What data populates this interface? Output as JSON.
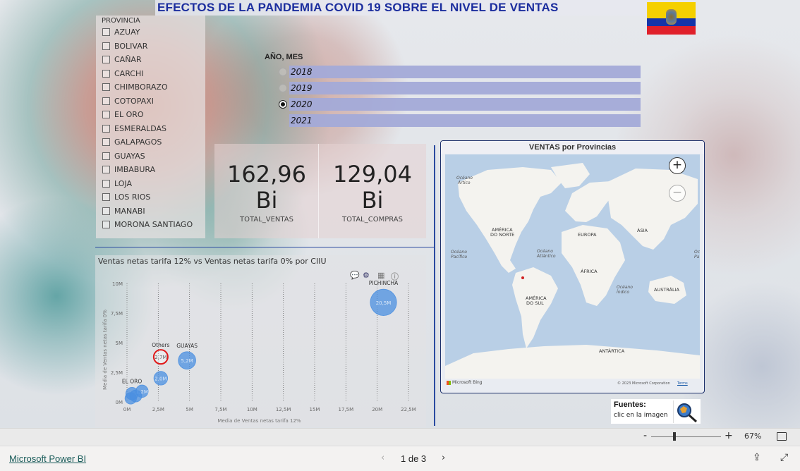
{
  "title": "EFECTOS DE LA PANDEMIA COVID 19 SOBRE EL NIVEL DE VENTAS",
  "flag_colors": {
    "yellow": "#f5d000",
    "blue": "#1534a8",
    "red": "#e0202a"
  },
  "provincia": {
    "header": "PROVINCIA",
    "items": [
      "AZUAY",
      "BOLIVAR",
      "CAÑAR",
      "CARCHI",
      "CHIMBORAZO",
      "COTOPAXI",
      "EL ORO",
      "ESMERALDAS",
      "GALAPAGOS",
      "GUAYAS",
      "IMBABURA",
      "LOJA",
      "LOS RIOS",
      "MANABI",
      "MORONA SANTIAGO"
    ]
  },
  "periodo": {
    "label": "AÑO, MES",
    "options": [
      {
        "label": "2018",
        "selected": false
      },
      {
        "label": "2019",
        "selected": false
      },
      {
        "label": "2020",
        "selected": true
      },
      {
        "label": "2021",
        "selected": false
      }
    ]
  },
  "kpis": [
    {
      "value": "162,96",
      "unit": "Bi",
      "label": "TOTAL_VENTAS"
    },
    {
      "value": "129,04",
      "unit": "Bi",
      "label": "TOTAL_COMPRAS"
    }
  ],
  "map": {
    "title": "VENTAS por Provincias",
    "labels": {
      "oceano_artico": [
        "Océano",
        "Ártico"
      ],
      "oceano_pacifico": [
        "Océano",
        "Pacífico"
      ],
      "oceano_atlantico": [
        "Océano",
        "Atlántico"
      ],
      "oceano_indico": [
        "Océano",
        "Índico"
      ],
      "america_norte": [
        "AMÉRICA",
        "DO NORTE"
      ],
      "america_sul": [
        "AMÉRICA",
        "DO SUL"
      ],
      "europa": "EUROPA",
      "asia": "ÁSIA",
      "africa": "ÁFRICA",
      "australia": "AUSTRÁLIA",
      "antartica": "ANTÁRTICA"
    },
    "zoom_in": "+",
    "zoom_out": "−",
    "provider": "Microsoft Bing",
    "copyright": "© 2023 Microsoft Corporation",
    "terms": "Terms"
  },
  "scatter": {
    "title": "Ventas netas tarifa 12% vs Ventas netas tarifa 0% por CIIU"
  },
  "chart_data": {
    "type": "scatter",
    "title": "Ventas netas tarifa 12% vs Ventas netas tarifa 0% por CIIU",
    "xlabel": "Media de Ventas netas tarifa 12%",
    "ylabel": "Media de Ventas netas tarifa 0%",
    "xlim": [
      0,
      22500000
    ],
    "ylim": [
      0,
      10000000
    ],
    "x_ticks": [
      "0M",
      "2,5M",
      "5M",
      "7,5M",
      "10M",
      "12,5M",
      "15M",
      "17,5M",
      "20M",
      "22,5M"
    ],
    "y_ticks": [
      "0M",
      "2,5M",
      "5M",
      "7,5M",
      "10M"
    ],
    "grid": "vertical dotted",
    "points": [
      {
        "name": "PICHINCHA",
        "x": 20500000,
        "y": 8400000,
        "size": 20.5,
        "label": "20,5M",
        "color": "#4a8fe0"
      },
      {
        "name": "GUAYAS",
        "x": 4800000,
        "y": 3500000,
        "size": 5.2,
        "label": "5,2M",
        "color": "#4a8fe0"
      },
      {
        "name": "Others",
        "x": 2700000,
        "y": 3800000,
        "size": 2.7,
        "label": "2,7M",
        "color": "#ffffff",
        "highlight": "#e01818"
      },
      {
        "name": "",
        "x": 2700000,
        "y": 2000000,
        "size": 1.8,
        "label": "2,0M",
        "color": "#4a8fe0"
      },
      {
        "name": "EL ORO",
        "x": 400000,
        "y": 700000,
        "size": 1.0,
        "label": "",
        "color": "#4a8fe0"
      },
      {
        "name": "",
        "x": 1200000,
        "y": 900000,
        "size": 1.0,
        "label": "1,2M",
        "color": "#4a8fe0"
      },
      {
        "name": "",
        "x": 700000,
        "y": 500000,
        "size": 0.8,
        "label": "",
        "color": "#4a8fe0"
      },
      {
        "name": "",
        "x": 300000,
        "y": 300000,
        "size": 0.6,
        "label": "",
        "color": "#4a8fe0"
      }
    ]
  },
  "fuentes": {
    "title": "Fuentes:",
    "subtitle": "clic en la imagen"
  },
  "zoom_bar": {
    "minus": "-",
    "plus": "+",
    "percent": "67%",
    "level": 0.33
  },
  "footer": {
    "brand": "Microsoft Power BI",
    "page": "1 de 3",
    "prev": "‹",
    "next": "›"
  }
}
